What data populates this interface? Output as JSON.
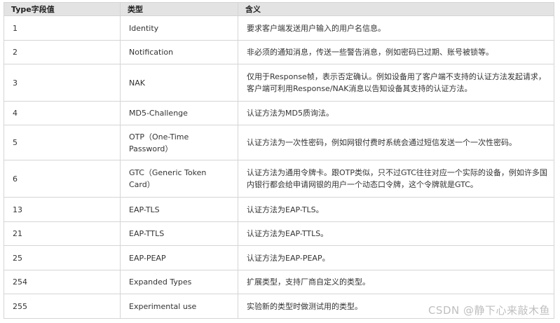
{
  "table": {
    "headers": [
      "Type字段值",
      "类型",
      "含义"
    ],
    "rows": [
      {
        "type": "1",
        "name": "Identity",
        "desc": "要求客户端发送用户输入的用户名信息。"
      },
      {
        "type": "2",
        "name": "Notification",
        "desc": "非必须的通知消息，传送一些警告消息，例如密码已过期、账号被锁等。"
      },
      {
        "type": "3",
        "name": "NAK",
        "desc": "仅用于Response帧，表示否定确认。例如设备用了客户端不支持的认证方法发起请求，客户端可利用Response/NAK消息以告知设备其支持的认证方法。"
      },
      {
        "type": "4",
        "name": "MD5-Challenge",
        "desc": "认证方法为MD5质询法。"
      },
      {
        "type": "5",
        "name": "OTP（One-Time Password）",
        "desc": "认证方法为一次性密码，例如网银付费时系统会通过短信发送一个一次性密码。"
      },
      {
        "type": "6",
        "name": "GTC（Generic Token Card）",
        "desc": "认证方法为通用令牌卡。跟OTP类似，只不过GTC往往对应一个实际的设备，例如许多国内银行都会给申请网银的用户一个动态口令牌，这个令牌就是GTC。"
      },
      {
        "type": "13",
        "name": "EAP-TLS",
        "desc": "认证方法为EAP-TLS。"
      },
      {
        "type": "21",
        "name": "EAP-TTLS",
        "desc": "认证方法为EAP-TTLS。"
      },
      {
        "type": "25",
        "name": "EAP-PEAP",
        "desc": "认证方法为EAP-PEAP。"
      },
      {
        "type": "254",
        "name": "Expanded Types",
        "desc": "扩展类型，支持厂商自定义的类型。"
      },
      {
        "type": "255",
        "name": "Experimental use",
        "desc": "实验新的类型时做测试用的类型。"
      }
    ]
  },
  "watermark": "CSDN @静下心来敲木鱼"
}
